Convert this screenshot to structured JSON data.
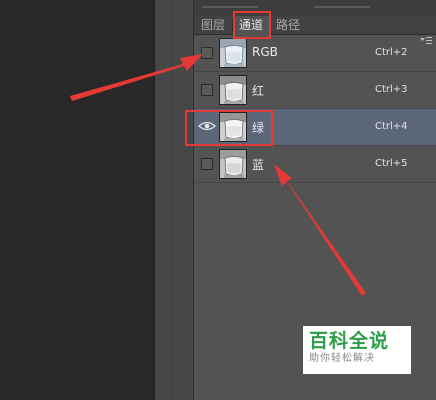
{
  "tabs": [
    {
      "label": "图层",
      "active": false
    },
    {
      "label": "通道",
      "active": true
    },
    {
      "label": "路径",
      "active": false
    }
  ],
  "channels": [
    {
      "name": "RGB",
      "shortcut": "Ctrl+2",
      "visible": false,
      "selected": false
    },
    {
      "name": "红",
      "shortcut": "Ctrl+3",
      "visible": false,
      "selected": false
    },
    {
      "name": "绿",
      "shortcut": "Ctrl+4",
      "visible": true,
      "selected": true
    },
    {
      "name": "蓝",
      "shortcut": "Ctrl+5",
      "visible": false,
      "selected": false
    }
  ],
  "icons": {
    "visibility": "eye-icon",
    "panel_menu": "panel-menu-icon",
    "thumbnail": "glass-thumbnail-icon"
  },
  "annotation": {
    "color": "#e53935"
  },
  "watermark": {
    "title": "百科全说",
    "subtitle": "助你轻松解决"
  }
}
